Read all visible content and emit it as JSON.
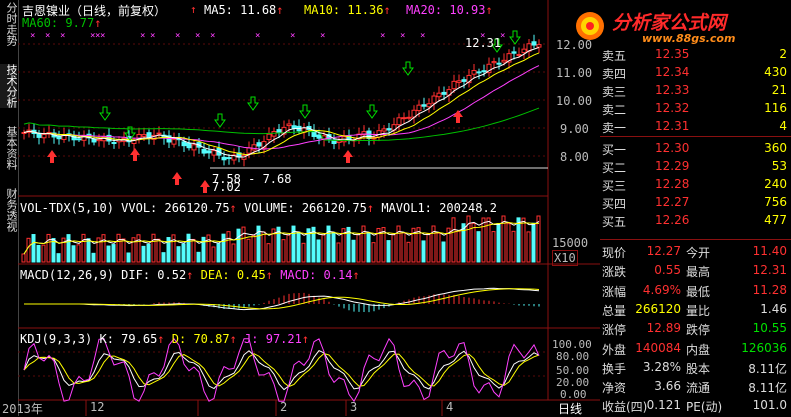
{
  "left_tabs": [
    "分时走势",
    "技术分析",
    "基本资料",
    "财务透视"
  ],
  "header": {
    "stock": "吉恩镍业（日线，前复权）",
    "ma5_label": "MA5:",
    "ma5": "11.68",
    "ma10_label": "MA10:",
    "ma10": "11.36",
    "ma20_label": "MA20:",
    "ma20": "10.93",
    "ma60_label": "MA60:",
    "ma60": "9.77"
  },
  "price_axis": [
    "12.00",
    "11.00",
    "10.00",
    "9.00",
    "8.00"
  ],
  "price_annotations": {
    "high": "12.31",
    "low_range": "7.58 - 7.68",
    "low": "7.02"
  },
  "volume_header": {
    "label": "VOL-TDX(5,10)",
    "vvol_label": "VVOL:",
    "vvol": "266120.75",
    "volume_label": "VOLUME:",
    "volume": "266120.75",
    "mavol1_label": "MAVOL1:",
    "mavol1": "200248.2"
  },
  "volume_axis": {
    "value": "15000",
    "unit": "X10"
  },
  "macd_header": {
    "label": "MACD(12,26,9)",
    "dif_label": "DIF:",
    "dif": "0.52",
    "dea_label": "DEA:",
    "dea": "0.45",
    "macd_label": "MACD:",
    "macd": "0.14"
  },
  "kdj_header": {
    "label": "KDJ(9,3,3)",
    "k_label": "K:",
    "k": "79.65",
    "d_label": "D:",
    "d": "70.87",
    "j_label": "J:",
    "j": "97.21"
  },
  "kdj_axis": [
    "100.00",
    "80.00",
    "50.00",
    "20.00",
    "0.00"
  ],
  "time_axis": [
    "2013年",
    "12",
    "2",
    "3",
    "4"
  ],
  "time_axis_unit": "日线",
  "watermark": {
    "title": "分析家公式网",
    "url": "www.88gs.com"
  },
  "order_book": [
    {
      "label": "卖五",
      "price": "12.35",
      "vol": "2"
    },
    {
      "label": "卖四",
      "price": "12.34",
      "vol": "430"
    },
    {
      "label": "卖三",
      "price": "12.33",
      "vol": "21"
    },
    {
      "label": "卖二",
      "price": "12.32",
      "vol": "116"
    },
    {
      "label": "卖一",
      "price": "12.31",
      "vol": "4"
    },
    {
      "label": "买一",
      "price": "12.30",
      "vol": "360"
    },
    {
      "label": "买二",
      "price": "12.29",
      "vol": "53"
    },
    {
      "label": "买三",
      "price": "12.28",
      "vol": "240"
    },
    {
      "label": "买四",
      "price": "12.27",
      "vol": "756"
    },
    {
      "label": "买五",
      "price": "12.26",
      "vol": "477"
    }
  ],
  "quote_stats": [
    {
      "l1": "现价",
      "v1": "12.27",
      "l2": "今开",
      "v2": "11.40"
    },
    {
      "l1": "涨跌",
      "v1": "0.55",
      "l2": "最高",
      "v2": "12.31"
    },
    {
      "l1": "涨幅",
      "v1": "4.69%",
      "l2": "最低",
      "v2": "11.28"
    },
    {
      "l1": "总量",
      "v1": "266120",
      "l2": "量比",
      "v2": "1.46"
    },
    {
      "l1": "涨停",
      "v1": "12.89",
      "l2": "跌停",
      "v2": "10.55"
    },
    {
      "l1": "外盘",
      "v1": "140084",
      "l2": "内盘",
      "v2": "126036"
    },
    {
      "l1": "换手",
      "v1": "3.28%",
      "l2": "股本",
      "v2": "8.11亿"
    },
    {
      "l1": "净资",
      "v1": "3.66",
      "l2": "流通",
      "v2": "8.11亿"
    },
    {
      "l1": "收益(四)",
      "v1": "0.121",
      "l2": "PE(动)",
      "v2": "101.0"
    }
  ],
  "colors": {
    "up": "#ff3030",
    "down": "#54fcfc",
    "ma5": "#ffffff",
    "ma10": "#ffff00",
    "ma20": "#ff40ff",
    "ma60": "#00c000",
    "grid": "#8a1010"
  }
}
